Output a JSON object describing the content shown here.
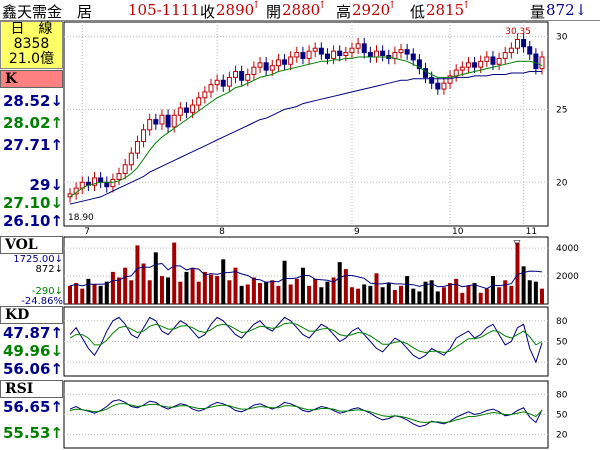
{
  "header": {
    "name": "鑫天需金　居",
    "date": "105-1111",
    "close_label": "收",
    "close_value": "2890",
    "close_arrow": "↑",
    "open_label": "開",
    "open_value": "2880",
    "open_arrow": "↑",
    "high_label": "高",
    "high_value": "2920",
    "high_arrow": "↑",
    "low_label": "低",
    "low_value": "2815",
    "low_arrow": "↑",
    "volume_label": "量",
    "volume_value": "872↓"
  },
  "info_box": {
    "line1": "日　線",
    "line2": "8358",
    "line3": "21.0億"
  },
  "price_panel": {
    "header": "K",
    "values": [
      {
        "text": "28.52↓",
        "color": "#00008b"
      },
      {
        "text": "28.02↑",
        "color": "#008000"
      },
      {
        "text": "27.71↑",
        "color": "#00008b"
      },
      {
        "text": "29↓",
        "color": "#00008b"
      },
      {
        "text": "27.10↓",
        "color": "#008000"
      },
      {
        "text": "26.10↑",
        "color": "#00008b"
      }
    ],
    "high_marker": "30.35",
    "low_marker": "18.90"
  },
  "vol_panel": {
    "header": "VOL",
    "values": [
      {
        "text": "1725.00↓",
        "color": "#00008b"
      },
      {
        "text": "872↓",
        "color": "#000000"
      },
      {
        "text": "-290↓",
        "color": "#008000"
      },
      {
        "text": "-24.86%",
        "color": "#00008b"
      }
    ],
    "marker": "▽"
  },
  "kd_panel": {
    "header": "KD",
    "values": [
      {
        "text": "47.87↑",
        "color": "#00008b"
      },
      {
        "text": "49.96↓",
        "color": "#008000"
      },
      {
        "text": "56.06↑",
        "color": "#00008b"
      }
    ]
  },
  "rsi_panel": {
    "header": "RSI",
    "values": [
      {
        "text": "56.65↑",
        "color": "#00008b"
      },
      {
        "text": "55.53↑",
        "color": "#008000"
      }
    ]
  },
  "chart_data": [
    {
      "type": "candlestick",
      "x_labels": [
        "7",
        "8",
        "9",
        "10",
        "11"
      ],
      "ylim": [
        17,
        31
      ],
      "yticks": [
        20,
        25,
        30
      ],
      "series": [
        {
          "values": [
            19.2,
            19.6,
            20.0,
            19.8,
            20.3,
            20.0,
            19.7,
            20.2,
            20.6,
            21.2,
            22.0,
            22.8,
            23.6,
            24.3,
            24.0,
            24.6,
            23.8,
            24.6,
            25.1,
            24.8,
            25.3,
            25.8,
            26.2,
            26.7,
            27.0,
            26.6,
            27.2,
            27.6,
            27.0,
            27.4,
            27.9,
            28.2,
            27.7,
            28.0,
            28.4,
            28.1,
            28.6,
            28.9,
            28.5,
            29.0,
            29.2,
            28.8,
            28.5,
            29.0,
            28.7,
            28.9,
            29.2,
            29.5,
            28.9,
            28.6,
            29.0,
            28.7,
            28.5,
            28.9,
            29.1,
            28.8,
            28.4,
            27.8,
            27.2,
            26.8,
            26.4,
            26.8,
            27.3,
            27.7,
            27.9,
            28.2,
            27.9,
            28.3,
            28.6,
            28.1,
            28.5,
            28.9,
            29.2,
            29.8,
            29.3,
            28.8,
            27.8,
            28.6
          ]
        },
        {
          "values": [
            19.0,
            19.3,
            19.6,
            19.8,
            19.9,
            20.0,
            20.0,
            20.0,
            20.1,
            20.3,
            20.6,
            21.0,
            21.6,
            22.2,
            22.7,
            23.1,
            23.4,
            23.7,
            24.0,
            24.3,
            24.6,
            24.9,
            25.2,
            25.5,
            25.8,
            26.0,
            26.2,
            26.5,
            26.6,
            26.8,
            27.0,
            27.2,
            27.3,
            27.4,
            27.6,
            27.7,
            27.8,
            27.9,
            28.0,
            28.1,
            28.2,
            28.3,
            28.3,
            28.4,
            28.4,
            28.5,
            28.5,
            28.6,
            28.6,
            28.6,
            28.6,
            28.6,
            28.6,
            28.5,
            28.4,
            28.3,
            28.1,
            27.9,
            27.6,
            27.4,
            27.2,
            27.2,
            27.2,
            27.3,
            27.4,
            27.5,
            27.6,
            27.7,
            27.8,
            27.9,
            28.0,
            28.1,
            28.2,
            28.3,
            28.3,
            28.3,
            28.2,
            28.0
          ]
        },
        {
          "values": [
            18.5,
            18.6,
            18.7,
            18.8,
            18.9,
            19.0,
            19.2,
            19.4,
            19.6,
            19.8,
            20.0,
            20.2,
            20.4,
            20.7,
            20.9,
            21.1,
            21.3,
            21.5,
            21.7,
            21.9,
            22.1,
            22.3,
            22.5,
            22.7,
            22.9,
            23.1,
            23.3,
            23.5,
            23.7,
            23.9,
            24.1,
            24.3,
            24.4,
            24.6,
            24.8,
            25.0,
            25.1,
            25.2,
            25.4,
            25.5,
            25.6,
            25.7,
            25.8,
            25.9,
            26.0,
            26.1,
            26.2,
            26.3,
            26.4,
            26.5,
            26.6,
            26.7,
            26.8,
            26.9,
            27.0,
            27.0,
            27.1,
            27.1,
            27.1,
            27.1,
            27.1,
            27.1,
            27.1,
            27.2,
            27.2,
            27.2,
            27.3,
            27.3,
            27.3,
            27.4,
            27.4,
            27.4,
            27.5,
            27.5,
            27.5,
            27.6,
            27.6,
            27.6
          ]
        }
      ]
    },
    {
      "type": "bar",
      "yticks": [
        2000,
        4000
      ],
      "ylim": [
        0,
        4800
      ],
      "values": [
        1300,
        1500,
        1100,
        1800,
        1400,
        1300,
        1600,
        2300,
        1900,
        2600,
        1700,
        4200,
        2900,
        1700,
        3700,
        2000,
        1900,
        4400,
        1600,
        2300,
        2600,
        1600,
        2300,
        2100,
        2000,
        3200,
        1700,
        2600,
        1300,
        1400,
        1900,
        1500,
        1600,
        1700,
        1300,
        3100,
        1400,
        1800,
        2600,
        1300,
        1800,
        1200,
        1600,
        1900,
        3000,
        2500,
        1200,
        1100,
        1400,
        1300,
        2200,
        1200,
        1500,
        1000,
        1300,
        2000,
        1100,
        900,
        1600,
        1700,
        900,
        1200,
        1500,
        1800,
        800,
        1300,
        1500,
        800,
        1100,
        2000,
        1200,
        1700,
        1300,
        4400,
        2700,
        1700,
        1600,
        1100
      ]
    },
    {
      "type": "line",
      "yticks": [
        20,
        50,
        80
      ],
      "ylim": [
        0,
        100
      ],
      "series": [
        {
          "values": [
            60,
            70,
            55,
            40,
            30,
            45,
            65,
            80,
            85,
            75,
            60,
            55,
            70,
            85,
            80,
            65,
            60,
            70,
            80,
            75,
            65,
            55,
            60,
            75,
            85,
            80,
            70,
            60,
            55,
            65,
            75,
            80,
            70,
            65,
            75,
            85,
            80,
            70,
            60,
            55,
            65,
            75,
            70,
            60,
            50,
            55,
            65,
            70,
            60,
            50,
            40,
            35,
            45,
            55,
            50,
            40,
            30,
            25,
            30,
            40,
            35,
            30,
            40,
            55,
            60,
            65,
            55,
            60,
            70,
            75,
            60,
            45,
            50,
            70,
            75,
            40,
            20,
            48
          ]
        },
        {
          "values": [
            55,
            60,
            60,
            55,
            45,
            45,
            52,
            62,
            70,
            72,
            68,
            63,
            65,
            72,
            75,
            72,
            68,
            68,
            72,
            73,
            70,
            65,
            63,
            67,
            73,
            75,
            73,
            68,
            63,
            64,
            68,
            72,
            71,
            69,
            71,
            76,
            77,
            75,
            70,
            65,
            65,
            68,
            69,
            66,
            60,
            58,
            60,
            63,
            62,
            58,
            52,
            46,
            46,
            49,
            50,
            47,
            41,
            36,
            34,
            36,
            36,
            34,
            36,
            42,
            48,
            54,
            54,
            56,
            61,
            66,
            64,
            58,
            55,
            60,
            65,
            57,
            45,
            50
          ]
        }
      ]
    },
    {
      "type": "line",
      "yticks": [
        20,
        50,
        80
      ],
      "ylim": [
        0,
        100
      ],
      "series": [
        {
          "values": [
            58,
            62,
            57,
            55,
            52,
            56,
            62,
            70,
            72,
            68,
            62,
            60,
            64,
            70,
            68,
            62,
            58,
            62,
            66,
            64,
            58,
            55,
            58,
            64,
            68,
            66,
            62,
            56,
            54,
            58,
            64,
            66,
            62,
            58,
            62,
            68,
            66,
            62,
            56,
            54,
            58,
            62,
            60,
            56,
            52,
            54,
            58,
            60,
            56,
            52,
            46,
            42,
            44,
            48,
            46,
            42,
            36,
            32,
            34,
            40,
            38,
            36,
            40,
            46,
            50,
            54,
            50,
            52,
            56,
            58,
            54,
            48,
            50,
            56,
            60,
            46,
            38,
            57
          ]
        },
        {
          "values": [
            56,
            58,
            57,
            56,
            54,
            55,
            58,
            63,
            66,
            66,
            64,
            62,
            63,
            65,
            65,
            63,
            61,
            61,
            63,
            63,
            61,
            59,
            59,
            61,
            63,
            64,
            63,
            60,
            58,
            58,
            60,
            62,
            61,
            60,
            60,
            63,
            63,
            62,
            59,
            57,
            57,
            59,
            59,
            58,
            55,
            55,
            56,
            57,
            56,
            54,
            51,
            48,
            47,
            48,
            47,
            45,
            42,
            39,
            38,
            39,
            39,
            38,
            39,
            42,
            44,
            47,
            47,
            49,
            51,
            53,
            52,
            50,
            50,
            52,
            54,
            51,
            47,
            56
          ]
        }
      ]
    }
  ]
}
